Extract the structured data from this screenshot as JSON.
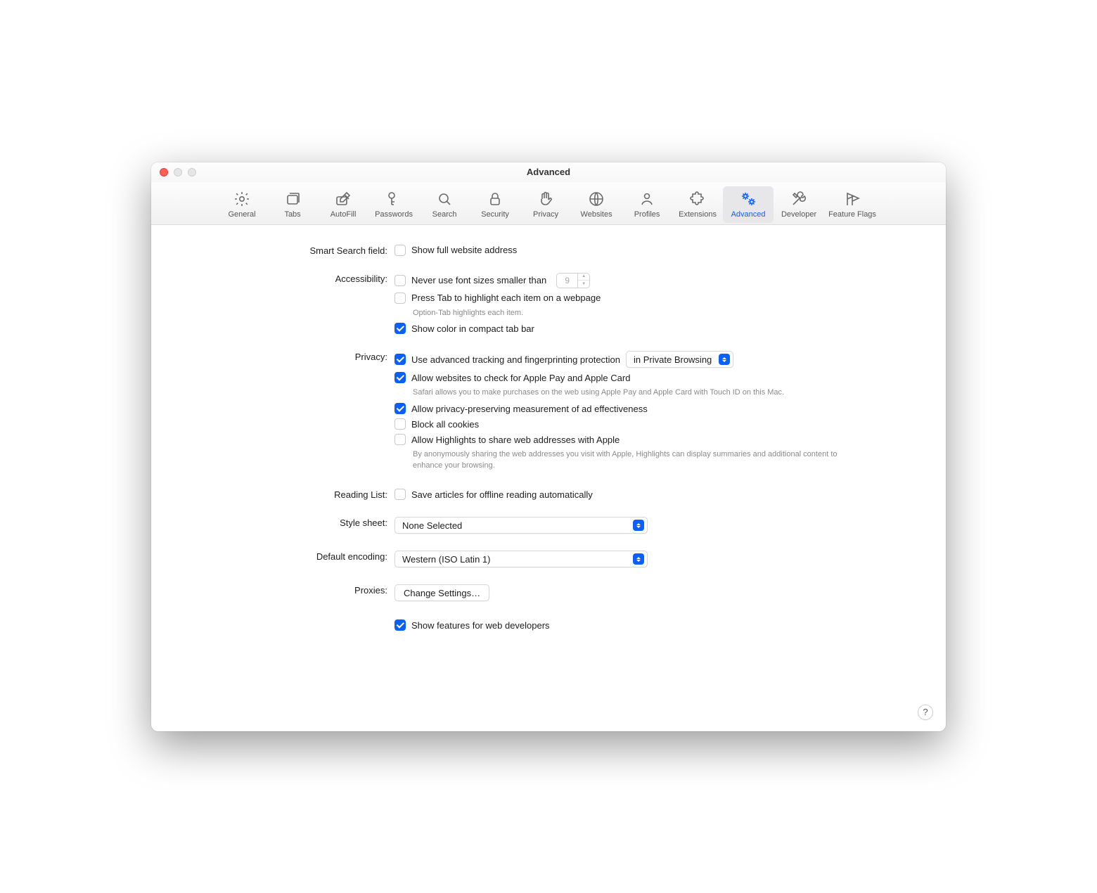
{
  "window": {
    "title": "Advanced"
  },
  "toolbar": [
    {
      "id": "general",
      "label": "General"
    },
    {
      "id": "tabs",
      "label": "Tabs"
    },
    {
      "id": "autofill",
      "label": "AutoFill"
    },
    {
      "id": "passwords",
      "label": "Passwords"
    },
    {
      "id": "search",
      "label": "Search"
    },
    {
      "id": "security",
      "label": "Security"
    },
    {
      "id": "privacy",
      "label": "Privacy"
    },
    {
      "id": "websites",
      "label": "Websites"
    },
    {
      "id": "profiles",
      "label": "Profiles"
    },
    {
      "id": "extensions",
      "label": "Extensions"
    },
    {
      "id": "advanced",
      "label": "Advanced",
      "active": true
    },
    {
      "id": "developer",
      "label": "Developer"
    },
    {
      "id": "featureflags",
      "label": "Feature Flags"
    }
  ],
  "sections": {
    "smart_search": {
      "label": "Smart Search field:",
      "show_full_address": {
        "checked": false,
        "text": "Show full website address"
      }
    },
    "accessibility": {
      "label": "Accessibility:",
      "min_font": {
        "checked": false,
        "text": "Never use font sizes smaller than",
        "value": "9"
      },
      "press_tab": {
        "checked": false,
        "text": "Press Tab to highlight each item on a webpage",
        "hint": "Option-Tab highlights each item."
      },
      "compact_color": {
        "checked": true,
        "text": "Show color in compact tab bar"
      }
    },
    "privacy": {
      "label": "Privacy:",
      "tracking": {
        "checked": true,
        "text": "Use advanced tracking and fingerprinting protection",
        "select_value": "in Private Browsing"
      },
      "apple_pay": {
        "checked": true,
        "text": "Allow websites to check for Apple Pay and Apple Card",
        "hint": "Safari allows you to make purchases on the web using Apple Pay and Apple Card with Touch ID on this Mac."
      },
      "ad_measure": {
        "checked": true,
        "text": "Allow privacy-preserving measurement of ad effectiveness"
      },
      "block_cookies": {
        "checked": false,
        "text": "Block all cookies"
      },
      "highlights": {
        "checked": false,
        "text": "Allow Highlights to share web addresses with Apple",
        "hint": "By anonymously sharing the web addresses you visit with Apple, Highlights can display summaries and additional content to enhance your browsing."
      }
    },
    "reading_list": {
      "label": "Reading List:",
      "offline": {
        "checked": false,
        "text": "Save articles for offline reading automatically"
      }
    },
    "stylesheet": {
      "label": "Style sheet:",
      "value": "None Selected"
    },
    "encoding": {
      "label": "Default encoding:",
      "value": "Western (ISO Latin 1)"
    },
    "proxies": {
      "label": "Proxies:",
      "button": "Change Settings…"
    },
    "developers": {
      "checked": true,
      "text": "Show features for web developers"
    }
  },
  "help_glyph": "?"
}
